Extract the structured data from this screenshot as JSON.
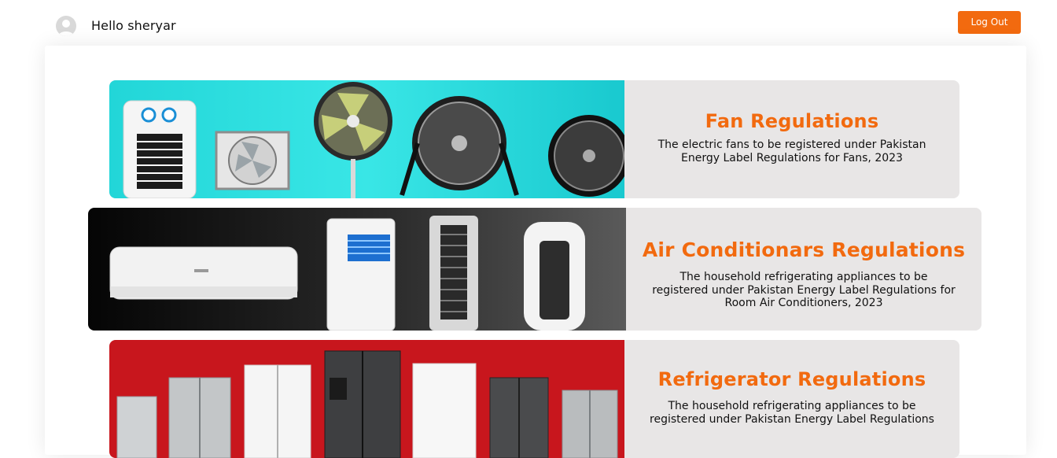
{
  "header": {
    "greeting": "Hello sheryar",
    "logout_label": "Log Out"
  },
  "colors": {
    "accent": "#f26a0f",
    "card_bg": "#e8e6e6"
  },
  "cards": [
    {
      "title": "Fan Regulations",
      "description": "The electric fans to be registered under Pakistan Energy Label Regulations for Fans, 2023",
      "image_icon": "fans-banner-icon"
    },
    {
      "title": "Air Conditionars Regulations",
      "description": "The household refrigerating appliances to be registered under Pakistan Energy Label Regulations for Room Air Conditioners, 2023",
      "image_icon": "air-conditioners-banner-icon"
    },
    {
      "title": "Refrigerator Regulations",
      "description": "The household refrigerating appliances to be registered under Pakistan Energy Label Regulations",
      "image_icon": "refrigerators-banner-icon"
    }
  ]
}
